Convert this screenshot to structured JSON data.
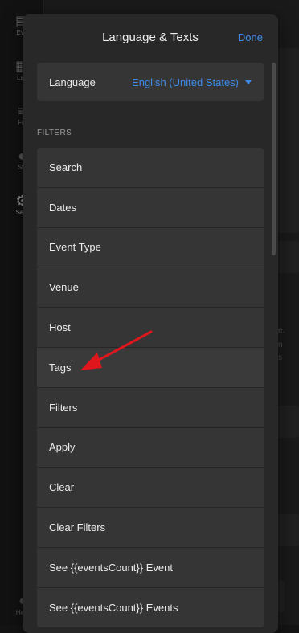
{
  "background": {
    "sidebar_items": [
      {
        "label": "Eve",
        "icon": "calendar-icon"
      },
      {
        "label": "Lay",
        "icon": "layout-icon"
      },
      {
        "label": "Filt",
        "icon": "filter-icon"
      },
      {
        "label": "Sty",
        "icon": "palette-icon"
      },
      {
        "label": "Setti",
        "icon": "gear-icon"
      }
    ],
    "help_label": "Help",
    "fragments": [
      "e.",
      "n",
      "s"
    ]
  },
  "modal": {
    "title": "Language & Texts",
    "done_label": "Done",
    "language": {
      "label": "Language",
      "value": "English (United States)"
    },
    "section_label": "FILTERS",
    "items": [
      "Search",
      "Dates",
      "Event Type",
      "Venue",
      "Host",
      "Tags",
      "Filters",
      "Apply",
      "Clear",
      "Clear Filters",
      "See {{eventsCount}} Event",
      "See {{eventsCount}} Events"
    ]
  },
  "annotation": {
    "arrow_color": "#e0161d"
  },
  "colors": {
    "accent": "#3f8ce8",
    "modal_bg": "#282828",
    "row_bg": "#353535"
  }
}
